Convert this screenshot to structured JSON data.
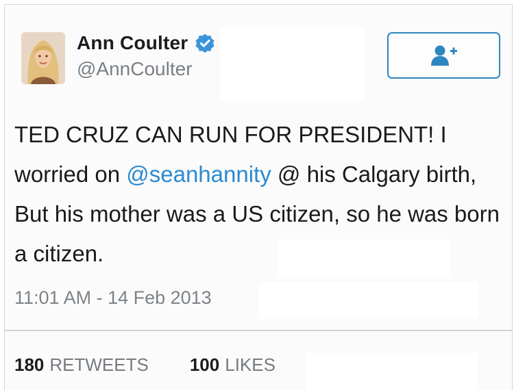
{
  "user": {
    "name": "Ann Coulter",
    "handle": "@AnnCoulter",
    "verified_icon": "verified-badge-icon",
    "avatar_icon": "profile-photo"
  },
  "follow_button": {
    "icon": "follow-user-plus-icon"
  },
  "tweet": {
    "text_before": "TED CRUZ CAN RUN FOR PRESIDENT!  I worried on ",
    "mention": "@seanhannity",
    "text_after": " @ his Calgary birth, But his mother was a US citizen, so he was born a citizen.",
    "timestamp": "11:01 AM - 14 Feb 2013"
  },
  "stats": {
    "retweets_count": "180",
    "retweets_label": "RETWEETS",
    "likes_count": "100",
    "likes_label": "LIKES"
  },
  "colors": {
    "accent": "#2a8ad1",
    "button_border": "#2e86c1",
    "muted_text": "#7a7f85"
  }
}
